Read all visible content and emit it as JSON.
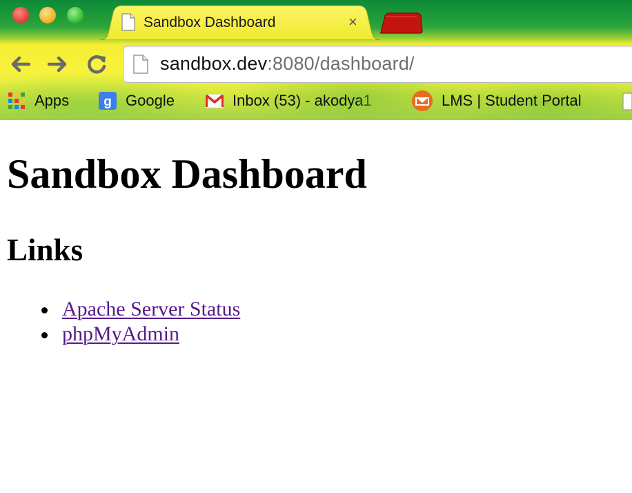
{
  "browser": {
    "tab": {
      "title": "Sandbox Dashboard",
      "close_glyph": "×"
    },
    "address_bar": {
      "host": "sandbox.dev",
      "rest": ":8080/dashboard/"
    },
    "nav_icons": [
      "back-arrow-icon",
      "forward-arrow-icon",
      "reload-icon"
    ],
    "bookmarks": [
      {
        "label": "Apps",
        "icon": "apps-grid-icon"
      },
      {
        "label": "Google",
        "icon": "google-icon"
      },
      {
        "label": "Inbox (53) - akodya1",
        "icon": "gmail-icon"
      },
      {
        "label": "LMS | Student Portal",
        "icon": "lms-icon"
      }
    ],
    "theme_colors": {
      "tab_strip": "#0e8a37",
      "toolbar": "#f3ee33",
      "new_tab": "#c4140e"
    }
  },
  "page": {
    "title": "Sandbox Dashboard",
    "section_heading": "Links",
    "links": [
      {
        "label": "Apache Server Status"
      },
      {
        "label": "phpMyAdmin"
      }
    ],
    "link_color": "#551a8b"
  }
}
